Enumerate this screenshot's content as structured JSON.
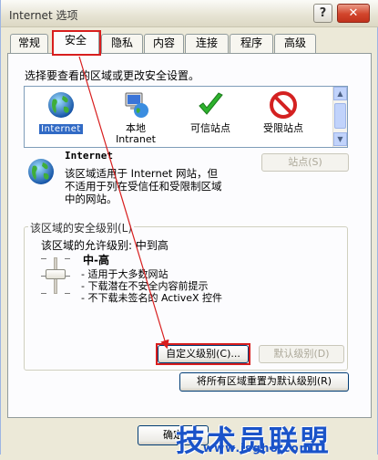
{
  "window": {
    "title": "Internet 选项"
  },
  "tabs": [
    {
      "label": "常规"
    },
    {
      "label": "安全"
    },
    {
      "label": "隐私"
    },
    {
      "label": "内容"
    },
    {
      "label": "连接"
    },
    {
      "label": "程序"
    },
    {
      "label": "高级"
    }
  ],
  "security": {
    "prompt": "选择要查看的区域或更改安全设置。",
    "zones": [
      {
        "name": "Internet",
        "icon": "globe-icon"
      },
      {
        "name_line1": "本地",
        "name_line2": "Intranet",
        "icon": "local-intranet-icon"
      },
      {
        "name": "可信站点",
        "icon": "checkmark-icon"
      },
      {
        "name": "受限站点",
        "icon": "restricted-icon"
      }
    ],
    "selected_zone": {
      "title": "Internet",
      "description_line1": "该区域适用于 Internet 网站，但",
      "description_line2": "不适用于列在受信任和受限制区域",
      "description_line3": "中的网站。"
    },
    "sites_button": "站点(S)",
    "level_group_title": "该区域的安全级别(L)",
    "allowed_levels": "该区域的允许级别: 中到高",
    "level_name": "中-高",
    "level_bullets": [
      "- 适用于大多数网站",
      "- 下载潜在不安全内容前提示",
      "- 不下载未签名的 ActiveX 控件"
    ],
    "custom_level_button": "自定义级别(C)...",
    "default_level_button": "默认级别(D)",
    "reset_all_button": "将所有区域重置为默认级别(R)"
  },
  "dialog_buttons": {
    "ok": "确定"
  },
  "watermark": {
    "text": "技术员联盟",
    "url": "www.jsgho.com"
  },
  "colors": {
    "highlight_red": "#d81e1e",
    "selection_blue": "#316ac5",
    "watermark_blue": "#1a53c9"
  }
}
